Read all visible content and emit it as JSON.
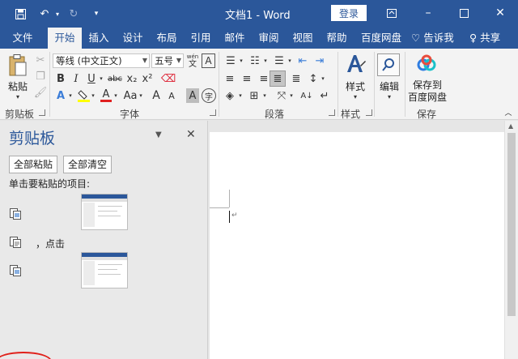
{
  "titlebar": {
    "title": "文档1 - Word",
    "login_label": "登录",
    "icons": [
      "save-icon",
      "undo-icon",
      "redo-icon",
      "customize-qat-icon",
      "ribbon-display-icon",
      "minimize-icon",
      "maximize-icon",
      "close-icon"
    ]
  },
  "tabs": [
    "文件",
    "开始",
    "插入",
    "设计",
    "布局",
    "引用",
    "邮件",
    "审阅",
    "视图",
    "帮助",
    "百度网盘"
  ],
  "active_tab": "开始",
  "tell_me": "告诉我",
  "share": "共享",
  "ribbon": {
    "clipboard": {
      "paste_label": "粘贴",
      "group_label": "剪贴板"
    },
    "font": {
      "font_name": "等线 (中文正文)",
      "font_size": "五号",
      "wen_label": "wén",
      "wen_char": "文",
      "char_border": "A",
      "group_label": "字体",
      "buttons": [
        "B",
        "I",
        "U",
        "abc",
        "x₂",
        "x²",
        "A",
        "A",
        "Aa",
        "A",
        "A",
        "A",
        "字"
      ]
    },
    "paragraph": {
      "group_label": "段落"
    },
    "styles": {
      "label": "样式",
      "group_label": "样式"
    },
    "editing": {
      "label": "编辑"
    },
    "save": {
      "label_line1": "保存到",
      "label_line2": "百度网盘",
      "group_label": "保存"
    }
  },
  "clipboard_pane": {
    "title": "剪贴板",
    "paste_all": "全部粘贴",
    "clear_all": "全部清空",
    "hint": "单击要粘贴的项目:",
    "text_item": "，点击"
  },
  "colors": {
    "word_blue": "#2b579a",
    "ribbon_bg": "#f3f3f3",
    "pane_bg": "#e9e9e9",
    "highlight": "#ffff00",
    "font_color": "#e02020",
    "annotation_red": "#e0201a"
  }
}
